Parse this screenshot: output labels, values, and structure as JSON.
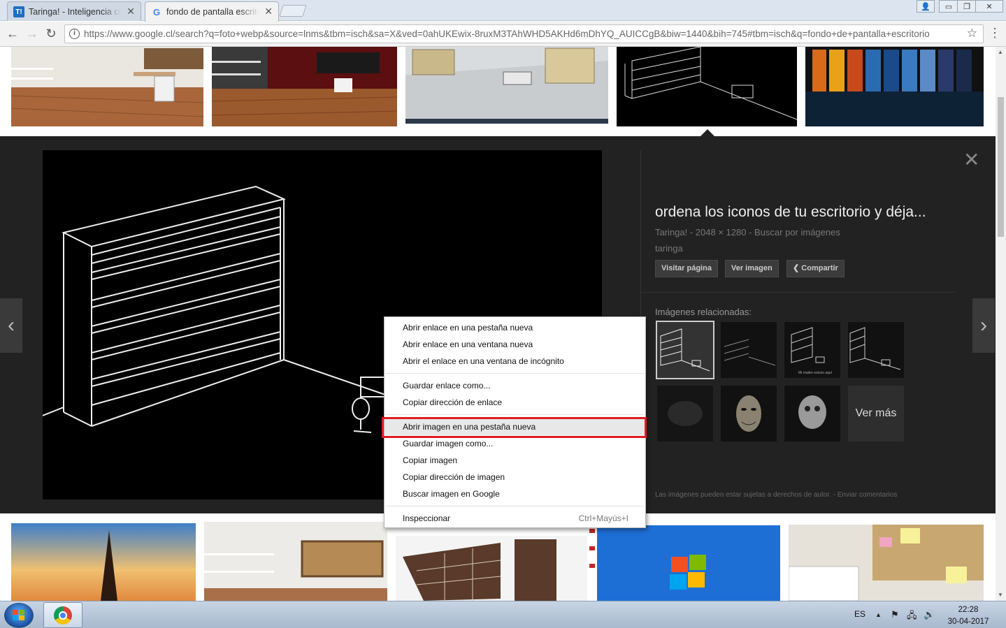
{
  "tabs": [
    {
      "title": "Taringa! - Inteligencia colectiva",
      "icon": "T!",
      "close": "✕"
    },
    {
      "title": "fondo de pantalla escritorio",
      "icon": "G",
      "close": "✕"
    }
  ],
  "window_controls": {
    "user": "👤",
    "minimize": "▭",
    "restore": "❐",
    "close": "✕"
  },
  "toolbar": {
    "back": "←",
    "forward": "→",
    "reload": "↻",
    "url": "https://www.google.cl/search?q=foto+webp&source=lnms&tbm=isch&sa=X&ved=0ahUKEwix-8ruxM3TAhWHD5AKHd6mDhYQ_AUICCgB&biw=1440&bih=745#tbm=isch&q=fondo+de+pantalla+escritorio",
    "star": "☆",
    "menu": "⋮"
  },
  "panel": {
    "title": "ordena los iconos de tu escritorio y déja...",
    "meta": "Taringa! - 2048 × 1280 - Buscar por imágenes",
    "domain": "taringa",
    "buttons": {
      "visit": "Visitar página",
      "view": "Ver imagen",
      "share": "Compartir"
    },
    "related_label": "Imágenes relacionadas:",
    "more": "Ver más",
    "legal": "Las imágenes pueden estar sujetas a derechos de autor.  -  Enviar comentarios",
    "close": "✕",
    "prev": "‹",
    "next": "›",
    "related_caption": "Mi madre estuvo aquí"
  },
  "context_menu": {
    "items": [
      {
        "label": "Abrir enlace en una pestaña nueva"
      },
      {
        "label": "Abrir enlace en una ventana nueva"
      },
      {
        "label": "Abrir el enlace en una ventana de incógnito"
      },
      {
        "label": "Guardar enlace como..."
      },
      {
        "label": "Copiar dirección de enlace"
      },
      {
        "label": "Abrir imagen en una pestaña nueva"
      },
      {
        "label": "Guardar imagen como..."
      },
      {
        "label": "Copiar imagen"
      },
      {
        "label": "Copiar dirección de imagen"
      },
      {
        "label": "Buscar imagen en Google"
      },
      {
        "label": "Inspeccionar",
        "shortcut": "Ctrl+Mayús+I"
      }
    ],
    "highlighted_item": "Abrir imagen en una pestaña nueva"
  },
  "taskbar": {
    "lang": "ES",
    "time": "22:28",
    "date": "30-04-2017",
    "tray_up": "▲",
    "flag": "⚑",
    "network": "🖧",
    "volume": "🔊"
  },
  "colors": {
    "highlight_border": "#e01d22",
    "panel_bg": "#222222"
  }
}
